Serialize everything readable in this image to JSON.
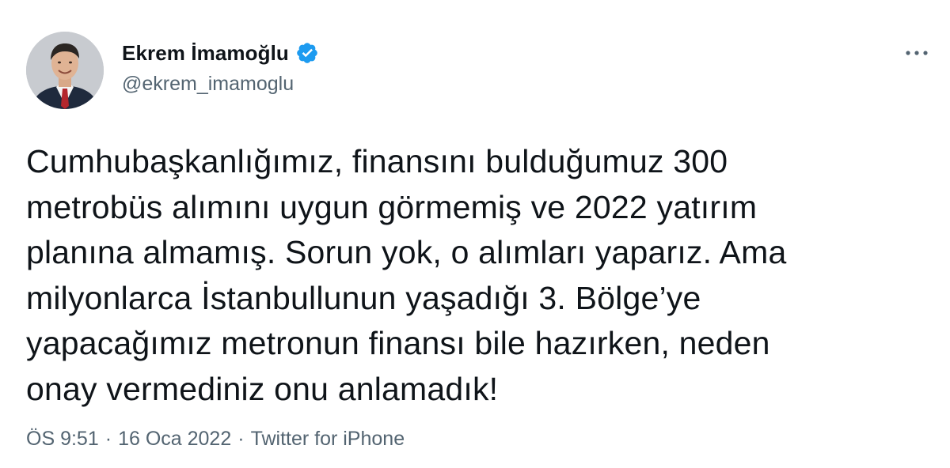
{
  "author": {
    "display_name": "Ekrem İmamoğlu",
    "handle": "@ekrem_imamoglu",
    "verified": true,
    "verified_color": "#1d9bf0"
  },
  "tweet": {
    "text": "Cumhubaşkanlığımız, finansını bulduğumuz 300\nmetrobüs alımını uygun görmemiş ve 2022 yatırım\nplanına almamış. Sorun yok, o alımları yaparız. Ama\nmilyonlarca İstanbullunun yaşadığı 3. Bölge’ye\nyapacağımız metronun finansı bile hazırken, neden\nonay vermediniz onu anlamadık!"
  },
  "meta": {
    "time": "ÖS 9:51",
    "separator": "·",
    "date": "16 Oca 2022",
    "source": "Twitter for iPhone"
  },
  "icons": {
    "more": "more-horizontal-icon",
    "verified": "verified-badge-icon"
  },
  "colors": {
    "text_primary": "#0f1419",
    "text_secondary": "#536471",
    "background": "#ffffff"
  }
}
